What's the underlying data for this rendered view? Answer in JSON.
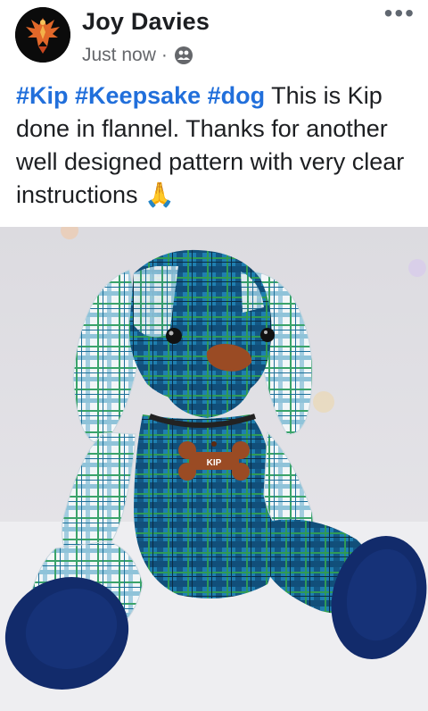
{
  "post": {
    "author": "Joy Davies",
    "timestamp": "Just now",
    "privacy_icon": "friends-icon",
    "more_icon": "more-horizontal-icon",
    "hashtags": [
      "#Kip",
      "#Keepsake",
      "#dog"
    ],
    "body": "This is Kip done in flannel. Thanks for another well designed pattern with very clear instructions",
    "emoji": "🙏",
    "photo": {
      "tag_text": "KIP"
    }
  },
  "colors": {
    "hashtag": "#216fdb",
    "text": "#1c1e21",
    "meta": "#65676b"
  }
}
